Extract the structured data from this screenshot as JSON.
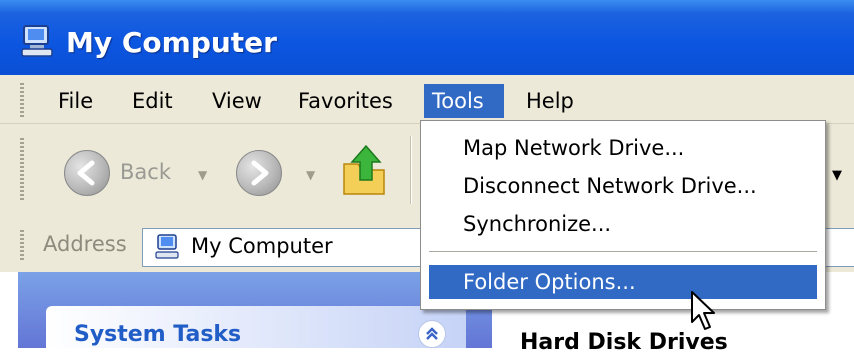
{
  "window": {
    "title": "My Computer",
    "icon": "my-computer-icon"
  },
  "menubar": {
    "items": [
      {
        "label": "File"
      },
      {
        "label": "Edit"
      },
      {
        "label": "View"
      },
      {
        "label": "Favorites"
      },
      {
        "label": "Tools",
        "active": true
      },
      {
        "label": "Help"
      }
    ]
  },
  "toolbar": {
    "back_label": "Back",
    "back_icon": "back-arrow-icon",
    "forward_icon": "forward-arrow-icon",
    "up_icon": "folder-up-icon"
  },
  "address": {
    "label": "Address",
    "value": "My Computer",
    "icon": "my-computer-icon"
  },
  "tools_menu": {
    "items": [
      {
        "label": "Map Network Drive..."
      },
      {
        "label": "Disconnect Network Drive..."
      },
      {
        "label": "Synchronize..."
      },
      {
        "label": "Folder Options...",
        "selected": true
      }
    ]
  },
  "task_pane": {
    "title": "System Tasks",
    "collapse_icon": "double-chevron-up-icon"
  },
  "main": {
    "section_title": "Hard Disk Drives"
  },
  "colors": {
    "title_bar": "#0a4fd6",
    "selection": "#316ac5",
    "menu_bg": "#ece9d8",
    "task_title": "#215dc6"
  }
}
